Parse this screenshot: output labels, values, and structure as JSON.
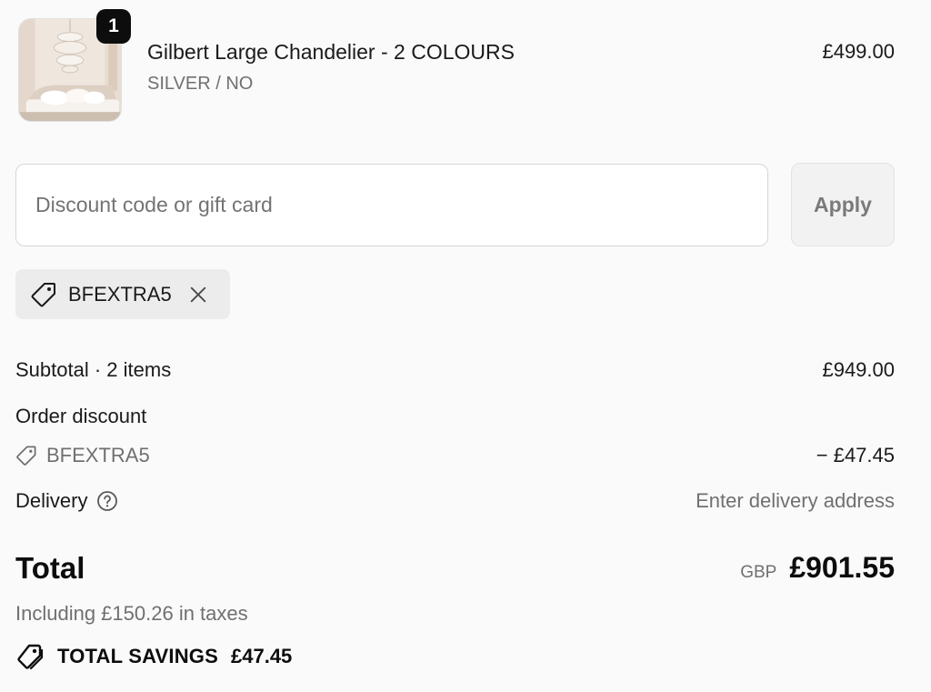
{
  "product": {
    "quantity": "1",
    "name": "Gilbert Large Chandelier - 2 COLOURS",
    "variant": "SILVER / NO",
    "price": "£499.00",
    "image_icon": "chandelier-bedroom-photo"
  },
  "discount": {
    "placeholder": "Discount code or gift card",
    "value": "",
    "apply_label": "Apply",
    "applied_code": "BFEXTRA5"
  },
  "summary": {
    "subtotal_label": "Subtotal · 2 items",
    "subtotal_value": "£949.00",
    "order_discount_label": "Order discount",
    "discount_code": "BFEXTRA5",
    "discount_value": "− £47.45",
    "delivery_label": "Delivery",
    "delivery_value": "Enter delivery address",
    "total_label": "Total",
    "total_currency": "GBP",
    "total_value": "£901.55",
    "taxes_note": "Including £150.26 in taxes",
    "savings_label": "TOTAL SAVINGS",
    "savings_value": "£47.45"
  },
  "colors": {
    "background": "#fafafa",
    "text": "#1a1a1a",
    "muted": "#707070",
    "chip": "#ececec",
    "badge": "#0d0d0d"
  }
}
